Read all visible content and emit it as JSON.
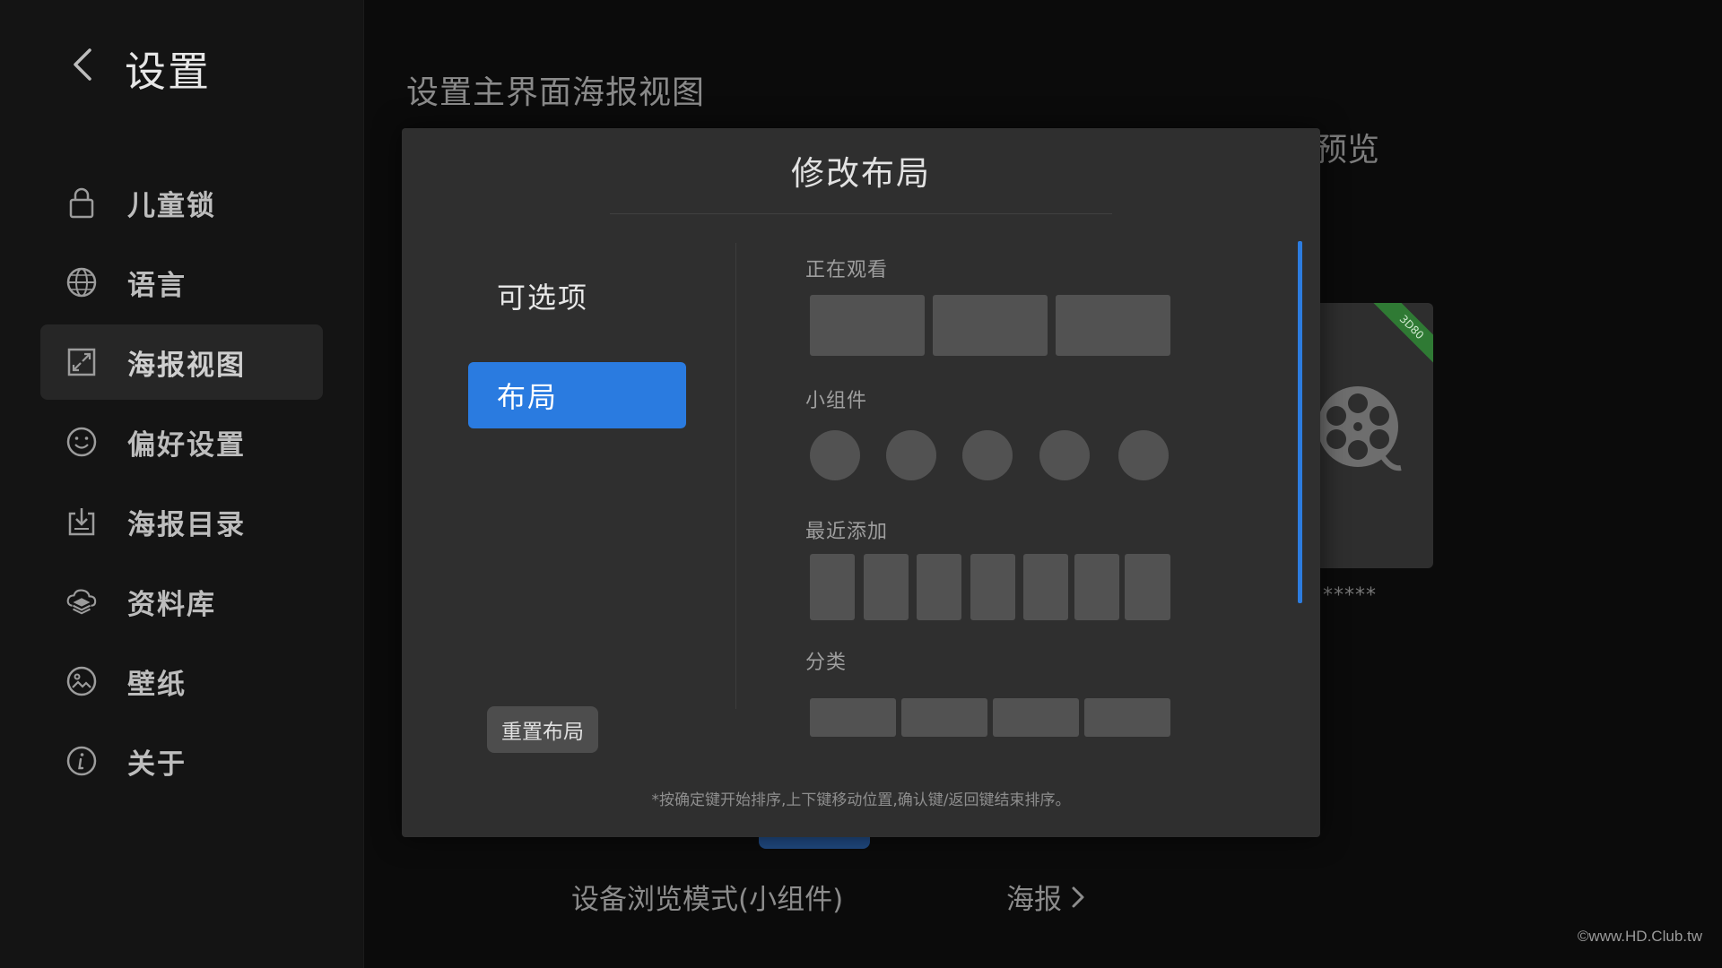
{
  "sidebar": {
    "title": "设置",
    "back_icon": "chevron-left-icon",
    "items": [
      {
        "label": "儿童锁",
        "icon": "lock-icon"
      },
      {
        "label": "语言",
        "icon": "globe-icon"
      },
      {
        "label": "海报视图",
        "icon": "expand-icon",
        "active": true
      },
      {
        "label": "偏好设置",
        "icon": "smiley-icon"
      },
      {
        "label": "海报目录",
        "icon": "download-icon"
      },
      {
        "label": "资料库",
        "icon": "layers-icon"
      },
      {
        "label": "壁纸",
        "icon": "image-icon"
      },
      {
        "label": "关于",
        "icon": "info-icon"
      }
    ]
  },
  "background": {
    "page_title": "设置主界面海报视图",
    "preview_label": "预览",
    "poster_badge": "3D80",
    "poster_rating": "*****",
    "mode_label": "设备浏览模式(小组件)",
    "poster_link": "海报"
  },
  "modal": {
    "title": "修改布局",
    "options_tab": "可选项",
    "layout_tab": "布局",
    "reset_button": "重置布局",
    "sections": {
      "watching": "正在观看",
      "widgets": "小组件",
      "recent": "最近添加",
      "categories": "分类"
    },
    "hint": "*按确定键开始排序,上下键移动位置,确认键/返回键结束排序。"
  },
  "watermark": "©www.HD.Club.tw",
  "colors": {
    "accent": "#2a7be0",
    "modal_bg": "#2f2f2f",
    "placeholder": "#525252"
  }
}
